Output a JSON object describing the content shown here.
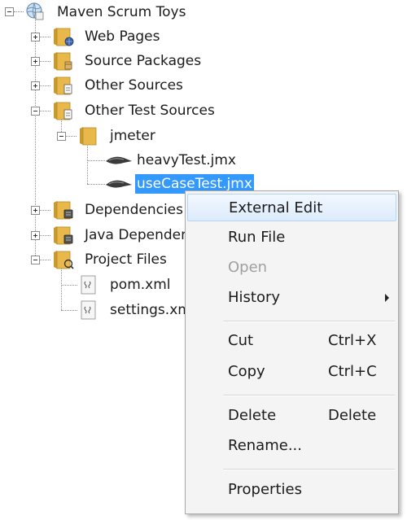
{
  "tree": {
    "root": "Maven Scrum Toys",
    "web_pages": "Web Pages",
    "source_packages": "Source Packages",
    "other_sources": "Other Sources",
    "other_test_sources": "Other Test Sources",
    "jmeter": "jmeter",
    "heavy_test": "heavyTest.jmx",
    "use_case_test": "useCaseTest.jmx",
    "dependencies": "Dependencies",
    "java_dependencies": "Java Dependencies",
    "project_files": "Project Files",
    "pom": "pom.xml",
    "settings": "settings.xml"
  },
  "context_menu": {
    "external_edit": "External Edit",
    "run_file": "Run File",
    "open": "Open",
    "history": "History",
    "cut": "Cut",
    "cut_shortcut": "Ctrl+X",
    "copy": "Copy",
    "copy_shortcut": "Ctrl+C",
    "delete": "Delete",
    "delete_shortcut": "Delete",
    "rename": "Rename...",
    "properties": "Properties"
  },
  "colors": {
    "selection": "#3399ff",
    "folder": "#e8b84a",
    "menu_background": "#f4f4f4"
  }
}
